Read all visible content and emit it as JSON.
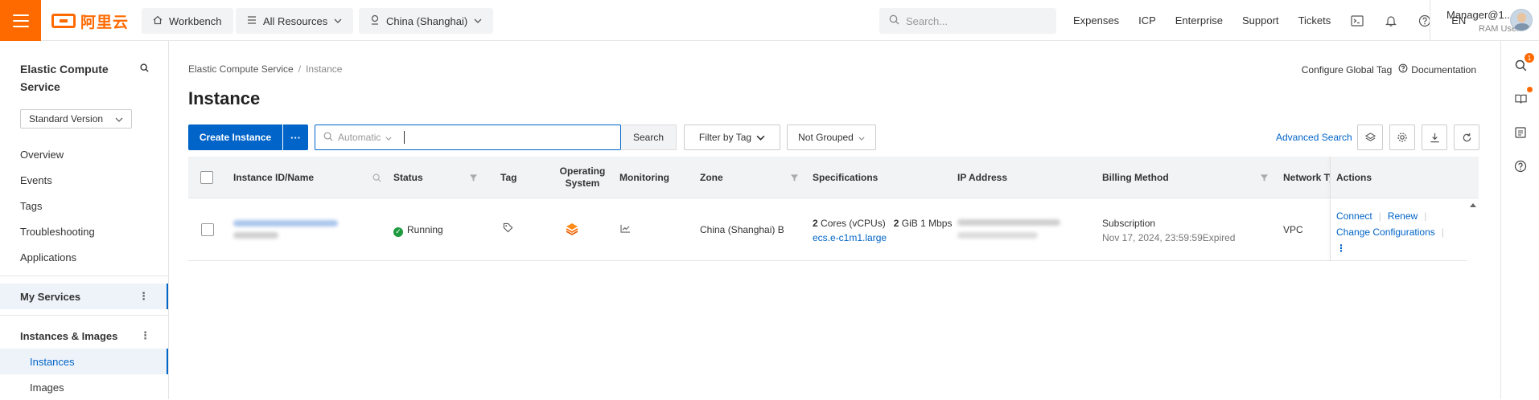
{
  "header": {
    "logo_text": "阿里云",
    "workbench_label": "Workbench",
    "resources_label": "All Resources",
    "region_label": "China (Shanghai)",
    "search_placeholder": "Search...",
    "links": [
      "Expenses",
      "ICP",
      "Enterprise",
      "Support",
      "Tickets"
    ],
    "lang": "EN",
    "user_name": "Manager@1...",
    "user_role": "RAM User",
    "accent_color": "#ff6a00"
  },
  "sidebar": {
    "title": "Elastic Compute Service",
    "version": "Standard Version",
    "items": [
      "Overview",
      "Events",
      "Tags",
      "Troubleshooting",
      "Applications"
    ],
    "my_services": "My Services",
    "section_instances": "Instances & Images",
    "sub_items": [
      "Instances",
      "Images"
    ]
  },
  "breadcrumb": {
    "root": "Elastic Compute Service",
    "current": "Instance"
  },
  "page": {
    "title": "Instance",
    "configure_tag": "Configure Global Tag",
    "documentation": "Documentation"
  },
  "toolbar": {
    "create_label": "Create Instance",
    "more_label": "···",
    "search_mode": "Automatic",
    "search_button": "Search",
    "filter_tag": "Filter by Tag",
    "grouping": "Not Grouped",
    "advanced_search": "Advanced Search",
    "primary_color": "#0064c8"
  },
  "table": {
    "headers": {
      "id": "Instance ID/Name",
      "status": "Status",
      "tag": "Tag",
      "os": "Operating System",
      "monitoring": "Monitoring",
      "zone": "Zone",
      "spec": "Specifications",
      "ip": "IP Address",
      "billing": "Billing Method",
      "network": "Network Ty",
      "actions": "Actions"
    },
    "row": {
      "status": "Running",
      "zone": "China (Shanghai) B",
      "spec_cores": "2",
      "spec_cores_unit": "Cores (vCPUs)",
      "spec_mem": "2",
      "spec_mem_unit": "GiB",
      "spec_bw": "1 Mbps",
      "spec_type": "ecs.e-c1m1.large",
      "billing": "Subscription",
      "expiry": "Nov 17, 2024, 23:59:59Expired",
      "network": "VPC",
      "actions": [
        "Connect",
        "Renew",
        "Change Configurations"
      ]
    }
  }
}
